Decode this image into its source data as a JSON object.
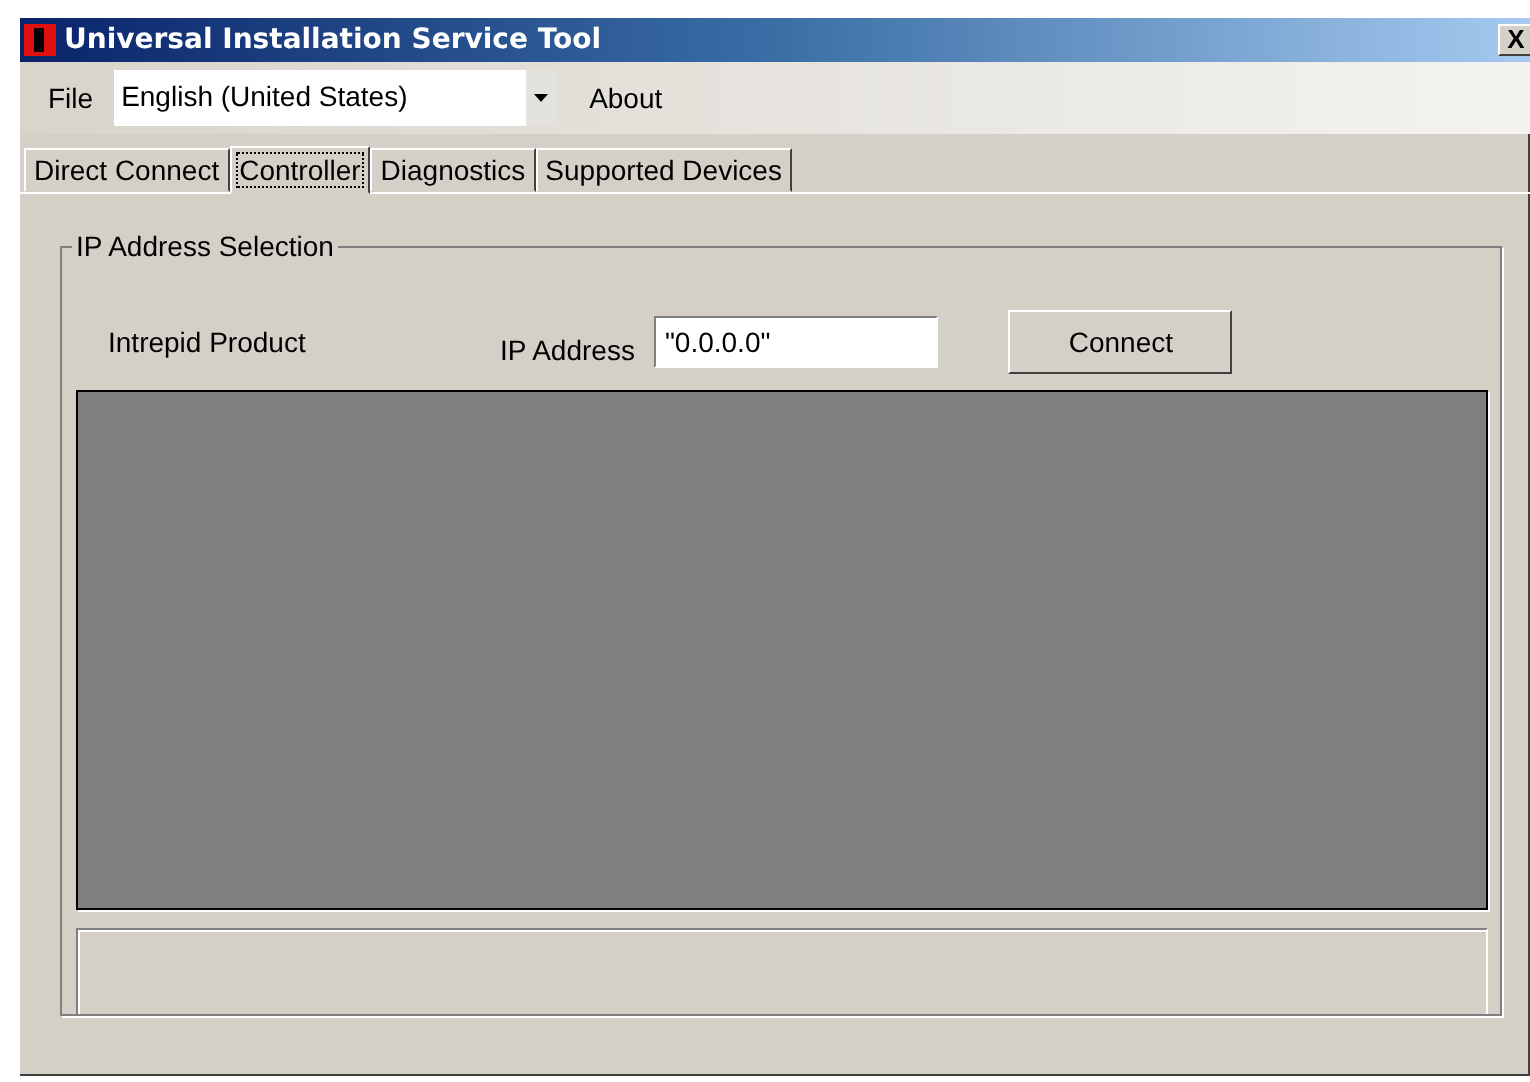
{
  "window": {
    "title": "Universal Installation Service Tool",
    "close": "X"
  },
  "menu": {
    "file": "File",
    "language": "English (United States)",
    "about": "About"
  },
  "tabs": [
    {
      "label": "Direct Connect",
      "selected": false
    },
    {
      "label": "Controller",
      "selected": true
    },
    {
      "label": "Diagnostics",
      "selected": false
    },
    {
      "label": "Supported Devices",
      "selected": false
    }
  ],
  "group": {
    "title": "IP Address Selection",
    "product_label": "Intrepid Product",
    "ip_label": "IP Address",
    "ip_value": "\"0.0.0.0\"",
    "connect": "Connect"
  }
}
